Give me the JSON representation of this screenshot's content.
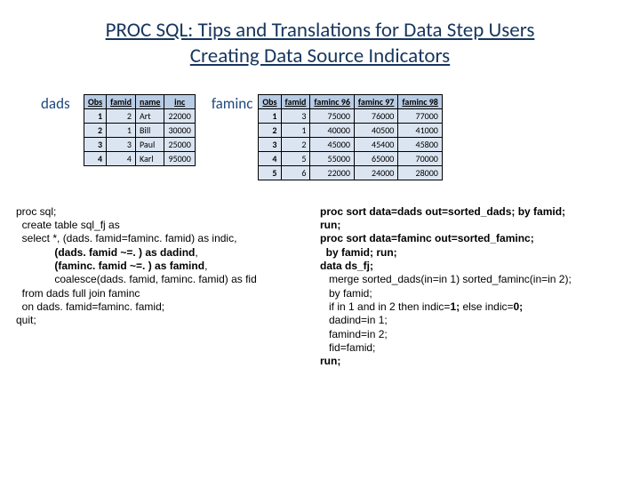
{
  "title_line1": "PROC SQL: Tips and Translations for Data Step Users",
  "title_line2": "Creating Data Source Indicators",
  "dads": {
    "label": "dads",
    "headers": [
      "Obs",
      "famid",
      "name",
      "inc"
    ],
    "rows": [
      [
        "1",
        "2",
        "Art",
        "22000"
      ],
      [
        "2",
        "1",
        "Bill",
        "30000"
      ],
      [
        "3",
        "3",
        "Paul",
        "25000"
      ],
      [
        "4",
        "4",
        "Karl",
        "95000"
      ]
    ]
  },
  "faminc": {
    "label": "faminc",
    "headers": [
      "Obs",
      "famid",
      "faminc 96",
      "faminc 97",
      "faminc 98"
    ],
    "rows": [
      [
        "1",
        "3",
        "75000",
        "76000",
        "77000"
      ],
      [
        "2",
        "1",
        "40000",
        "40500",
        "41000"
      ],
      [
        "3",
        "2",
        "45000",
        "45400",
        "45800"
      ],
      [
        "4",
        "5",
        "55000",
        "65000",
        "70000"
      ],
      [
        "5",
        "6",
        "22000",
        "24000",
        "28000"
      ]
    ]
  },
  "code_left": {
    "l1": "proc sql;",
    "l2": "  create table sql_fj as",
    "l3": "  select *, (dads. famid=faminc. famid) as indic,",
    "l4a": "             (dads. famid ~=. ) as dadind",
    "l4b": ",",
    "l5a": "             (faminc. famid ~=. ) as famind",
    "l5b": ",",
    "l6": "             coalesce(dads. famid, faminc. famid) as fid",
    "l7": "  from dads full join faminc",
    "l8": "  on dads. famid=faminc. famid;",
    "l9": "quit;"
  },
  "code_right": {
    "l1": "proc sort data=dads out=sorted_dads; by famid;",
    "l2": "run;",
    "l3": "proc sort data=faminc out=sorted_faminc;",
    "l4": "  by famid; run;",
    "l5": "data ds_fj;",
    "l6": "   merge sorted_dads(in=in 1) sorted_faminc(in=in 2);",
    "l7": "   by famid;",
    "l8a": "   if in 1 and in 2 then indic=",
    "l8b": "1; ",
    "l8c": "else indic=",
    "l8d": "0;",
    "l9": "   dadind=in 1;",
    "l10": "   famind=in 2;",
    "l11": "   fid=famid;",
    "l12": "run;"
  }
}
